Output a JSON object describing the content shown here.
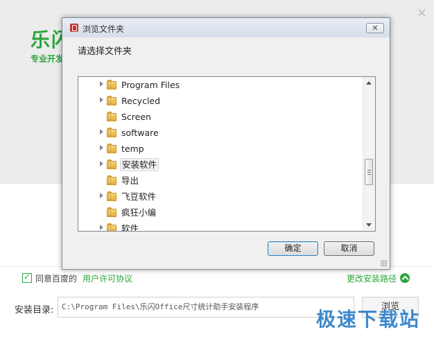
{
  "installer": {
    "close_symbol": "×",
    "brand_title": "乐闪",
    "brand_subtitle": "专业开发",
    "agree_text": "同意百度的",
    "agree_link": "用户许可协议",
    "change_path": "更改安装路径",
    "dir_label": "安装目录:",
    "dir_value": "C:\\Program Files\\乐闪Office尺寸统计助手安装程序",
    "browse_label": "浏览",
    "watermark": "极速下载站",
    "accent_color": "#2aa53a"
  },
  "dialog": {
    "title": "浏览文件夹",
    "close_symbol": "✕",
    "prompt": "请选择文件夹",
    "folders": [
      {
        "label": "Program Files",
        "expandable": true,
        "selected": false
      },
      {
        "label": "Recycled",
        "expandable": true,
        "selected": false
      },
      {
        "label": "Screen",
        "expandable": false,
        "selected": false
      },
      {
        "label": "software",
        "expandable": true,
        "selected": false
      },
      {
        "label": "temp",
        "expandable": true,
        "selected": false
      },
      {
        "label": "安装软件",
        "expandable": true,
        "selected": true
      },
      {
        "label": "导出",
        "expandable": false,
        "selected": false
      },
      {
        "label": "飞豆软件",
        "expandable": true,
        "selected": false
      },
      {
        "label": "疯狂小编",
        "expandable": false,
        "selected": false
      },
      {
        "label": "软件",
        "expandable": true,
        "selected": false
      }
    ],
    "ok_label": "确定",
    "cancel_label": "取消"
  }
}
